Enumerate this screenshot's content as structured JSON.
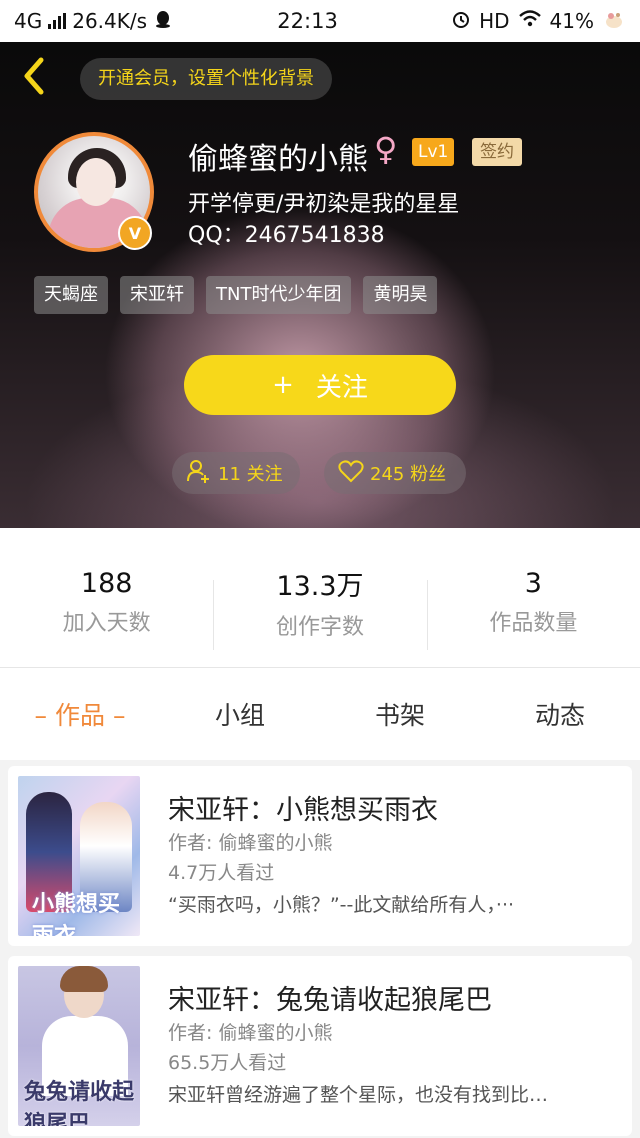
{
  "status_bar": {
    "network": "4G",
    "speed": "26.4K/s",
    "time": "22:13",
    "hd": "HD",
    "battery": "41%"
  },
  "header": {
    "vip_banner": "开通会员，设置个性化背景",
    "nickname": "偷蜂蜜的小熊",
    "gender_symbol": "♀",
    "level": "Lv1",
    "signed_badge": "签约",
    "avatar_badge": "V",
    "bio": "开学停更/尹初染是我的星星",
    "qq": "QQ：2467541838",
    "tags": [
      "天蝎座",
      "宋亚轩",
      "TNT时代少年团",
      "黄明昊"
    ],
    "follow_button": {
      "plus": "+",
      "label": "关注"
    },
    "following_pill": "11 关注",
    "fans_pill": "245 粉丝",
    "accent_color": "#f7d81a"
  },
  "stats": [
    {
      "value": "188",
      "label": "加入天数"
    },
    {
      "value": "13.3万",
      "label": "创作字数"
    },
    {
      "value": "3",
      "label": "作品数量"
    }
  ],
  "tabs": [
    {
      "label": "– 作品 –",
      "active": true
    },
    {
      "label": "小组",
      "active": false
    },
    {
      "label": "书架",
      "active": false
    },
    {
      "label": "动态",
      "active": false
    }
  ],
  "books": [
    {
      "title": "宋亚轩：小熊想买雨衣",
      "author": "作者: 偷蜂蜜的小熊",
      "views": "4.7万人看过",
      "desc": "“买雨衣吗，小熊？”--此文献给所有人，···",
      "cover_text": "小熊想买雨衣"
    },
    {
      "title": "宋亚轩：兔兔请收起狼尾巴",
      "author": "作者: 偷蜂蜜的小熊",
      "views": "65.5万人看过",
      "desc": "宋亚轩曾经游遍了整个星际，也没有找到比…",
      "cover_text": "兔兔请收起狼尾巴"
    }
  ]
}
